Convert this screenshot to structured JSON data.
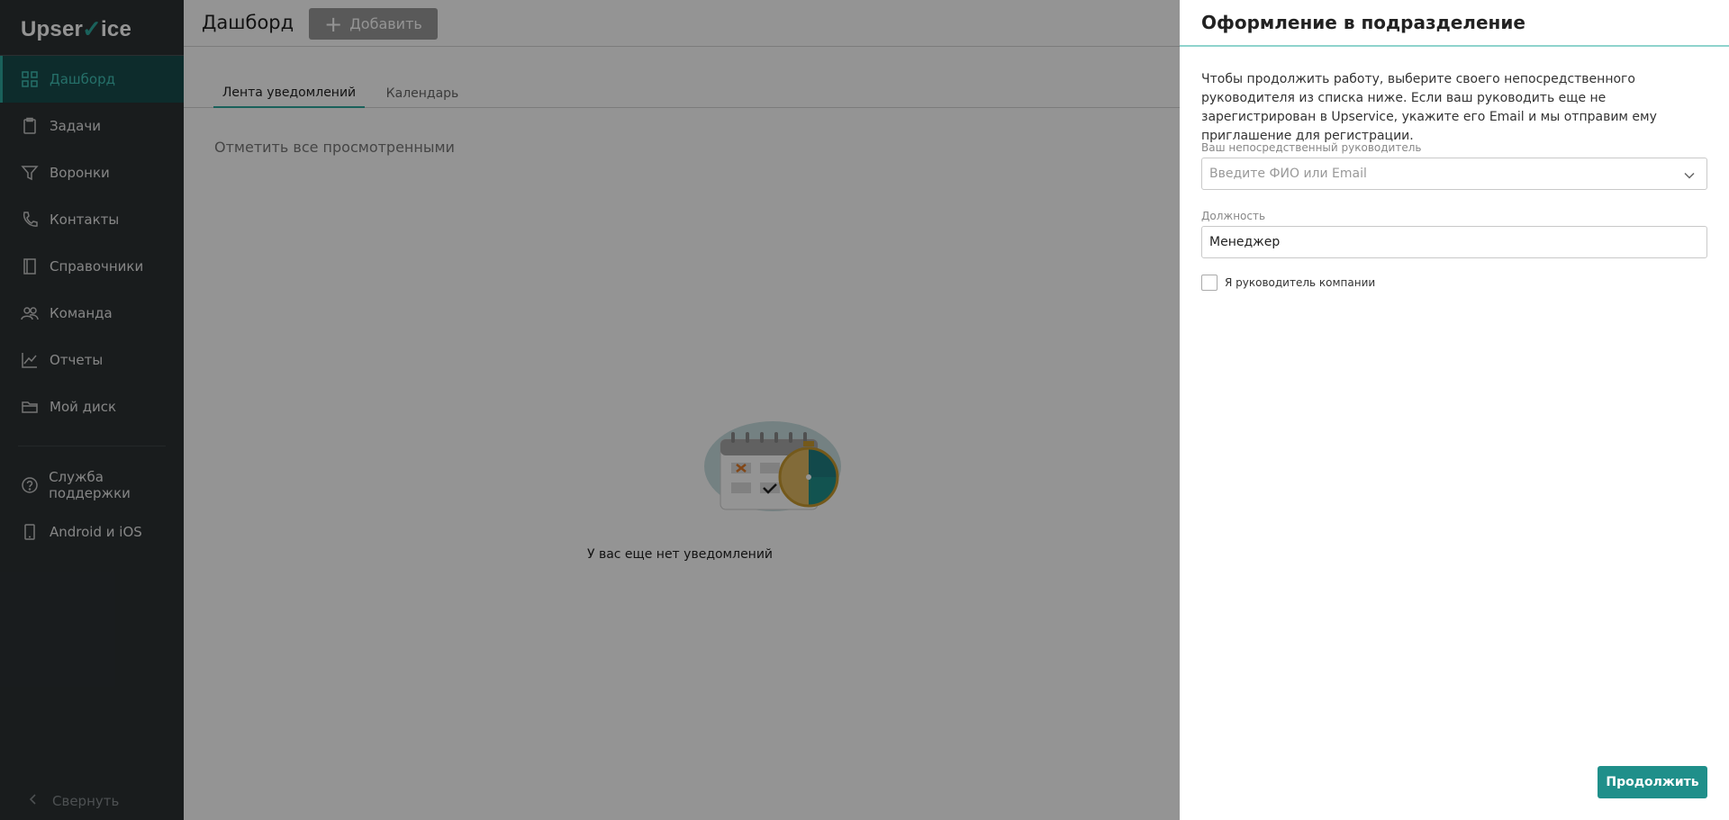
{
  "brand": {
    "logo_left": "Upser",
    "logo_right": "ice",
    "accent_color": "#2ea89e"
  },
  "sidebar": {
    "items": [
      {
        "label": "Дашборд",
        "icon": "grid-icon",
        "active": true
      },
      {
        "label": "Задачи",
        "icon": "clipboard-icon"
      },
      {
        "label": "Воронки",
        "icon": "funnel-icon"
      },
      {
        "label": "Контакты",
        "icon": "phone-icon"
      },
      {
        "label": "Справочники",
        "icon": "book-icon"
      },
      {
        "label": "Команда",
        "icon": "users-icon"
      },
      {
        "label": "Отчеты",
        "icon": "chart-icon"
      },
      {
        "label": "Мой диск",
        "icon": "folder-icon"
      }
    ],
    "secondary": [
      {
        "label": "Служба поддержки",
        "icon": "help-icon"
      },
      {
        "label": "Android и iOS",
        "icon": "mobile-icon"
      }
    ],
    "collapse_label": "Свернуть"
  },
  "main": {
    "title": "Дашборд",
    "add_label": "Добавить",
    "tabs": [
      {
        "label": "Лента уведомлений",
        "active": true
      },
      {
        "label": "Календарь",
        "active": false
      }
    ],
    "mark_all_label": "Отметить все просмотренными",
    "empty_text": "У вас еще нет уведомлений"
  },
  "panel": {
    "title": "Оформление в подразделение",
    "description": "Чтобы продолжить работу, выберите своего непосредственного руководителя из списка ниже. Если ваш руководить еще не зарегистрирован в Upservice, укажите его Email и мы отправим ему приглашение для регистрации.",
    "manager_label": "Ваш непосредственный руководитель",
    "manager_placeholder": "Введите ФИО или Email",
    "position_label": "Должность",
    "position_value": "Менеджер",
    "ceo_checkbox_label": "Я руководитель компании",
    "continue_label": "Продолжить"
  }
}
